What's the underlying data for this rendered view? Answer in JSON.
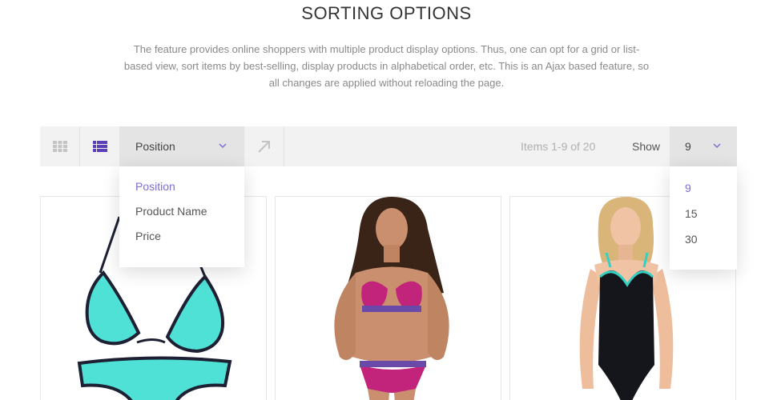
{
  "header": {
    "title": "SORTING OPTIONS",
    "description": "The feature provides online shoppers with multiple product display options. Thus, one can opt for a grid or list-based view, sort items by best-selling, display products in alphabetical order, etc. This is an Ajax based feature, so all changes are applied without reloading the page."
  },
  "toolbar": {
    "view_modes": [
      {
        "icon": "grid-icon",
        "active": false
      },
      {
        "icon": "list-icon",
        "active": true
      }
    ],
    "sort": {
      "selected": "Position",
      "options": [
        "Position",
        "Product Name",
        "Price"
      ],
      "direction_icon": "arrow-up-right-icon"
    },
    "items_count": "Items 1-9 of 20",
    "show_label": "Show",
    "show": {
      "selected": "9",
      "options": [
        "9",
        "15",
        "30"
      ]
    }
  },
  "colors": {
    "accent": "#5b3fb8",
    "active_option": "#7c6fd3",
    "toolbar_bg": "#f2f2f2",
    "select_bg": "#e4e4e4"
  },
  "products": [
    {
      "image": "turquoise-bikini"
    },
    {
      "image": "pink-paisley-bikini"
    },
    {
      "image": "black-one-piece-swimsuit"
    }
  ]
}
